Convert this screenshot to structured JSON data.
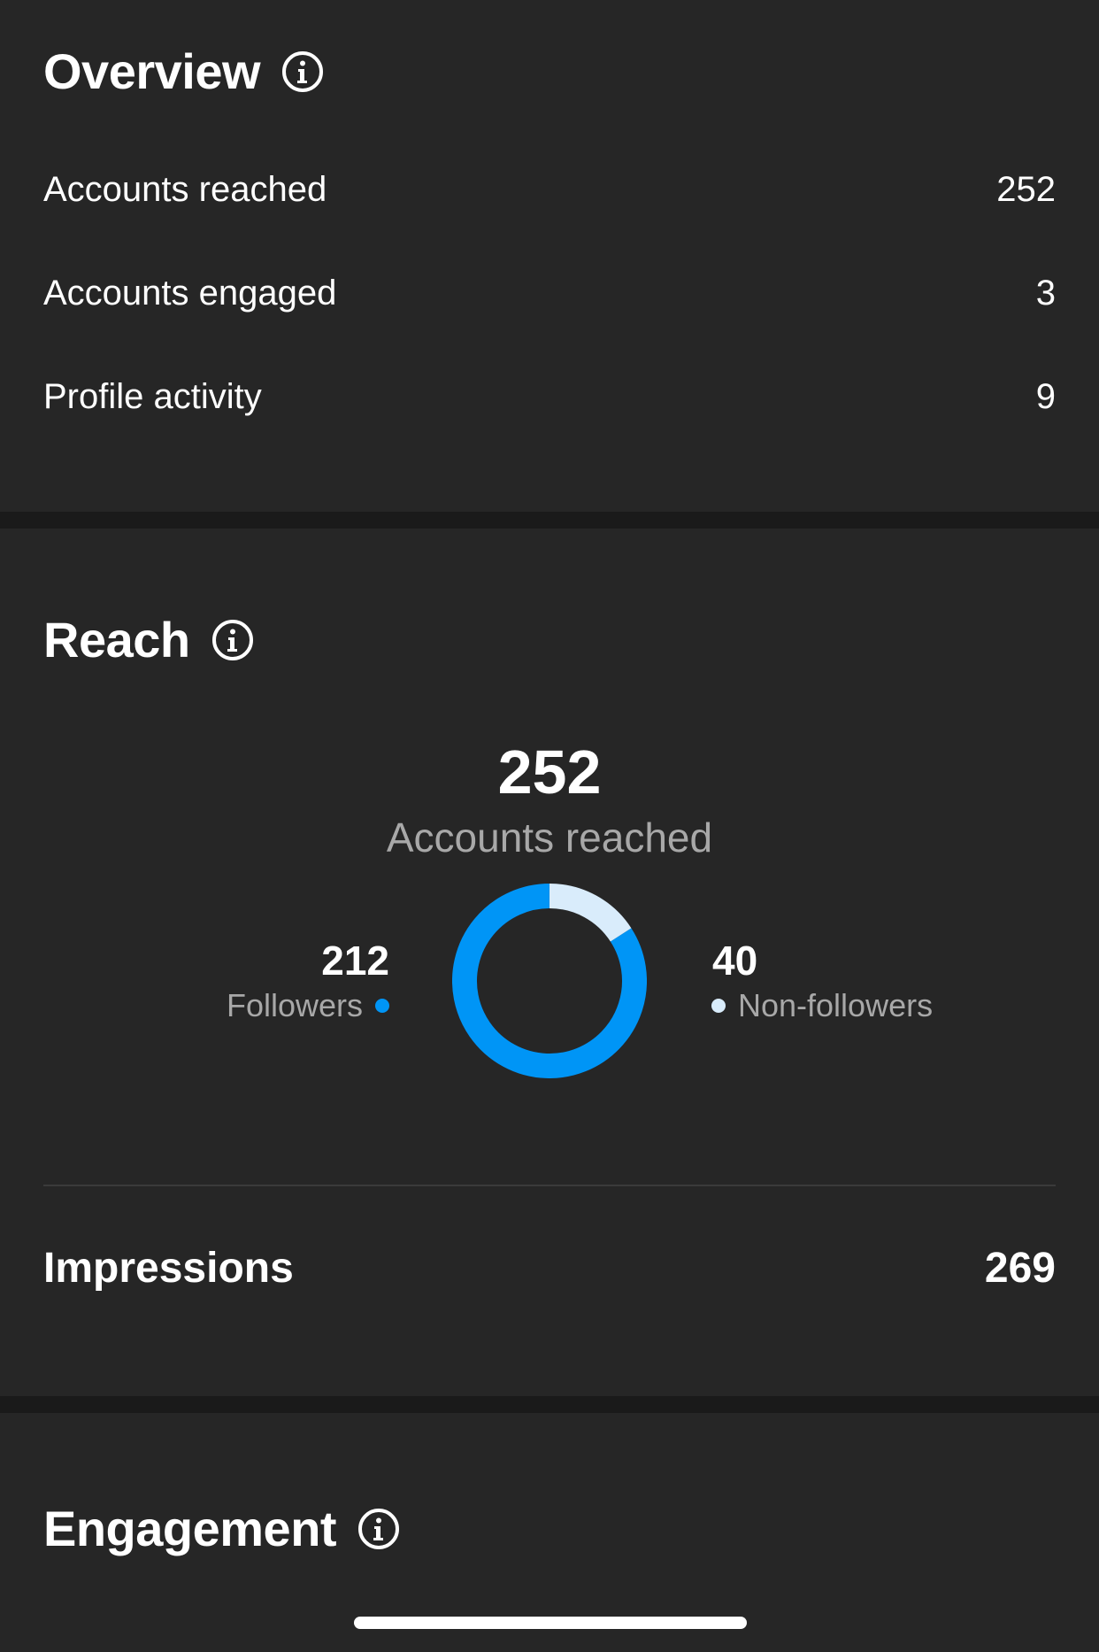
{
  "overview": {
    "title": "Overview",
    "rows": [
      {
        "label": "Accounts reached",
        "value": "252"
      },
      {
        "label": "Accounts engaged",
        "value": "3"
      },
      {
        "label": "Profile activity",
        "value": "9"
      }
    ]
  },
  "reach": {
    "title": "Reach",
    "total": "252",
    "total_label": "Accounts reached",
    "followers": {
      "value": "212",
      "label": "Followers",
      "color": "#0095f6"
    },
    "non_followers": {
      "value": "40",
      "label": "Non-followers",
      "color": "#d9ecfb"
    },
    "impressions": {
      "label": "Impressions",
      "value": "269"
    }
  },
  "engagement": {
    "title": "Engagement"
  },
  "icons": {
    "info": "info-circle-icon"
  }
}
